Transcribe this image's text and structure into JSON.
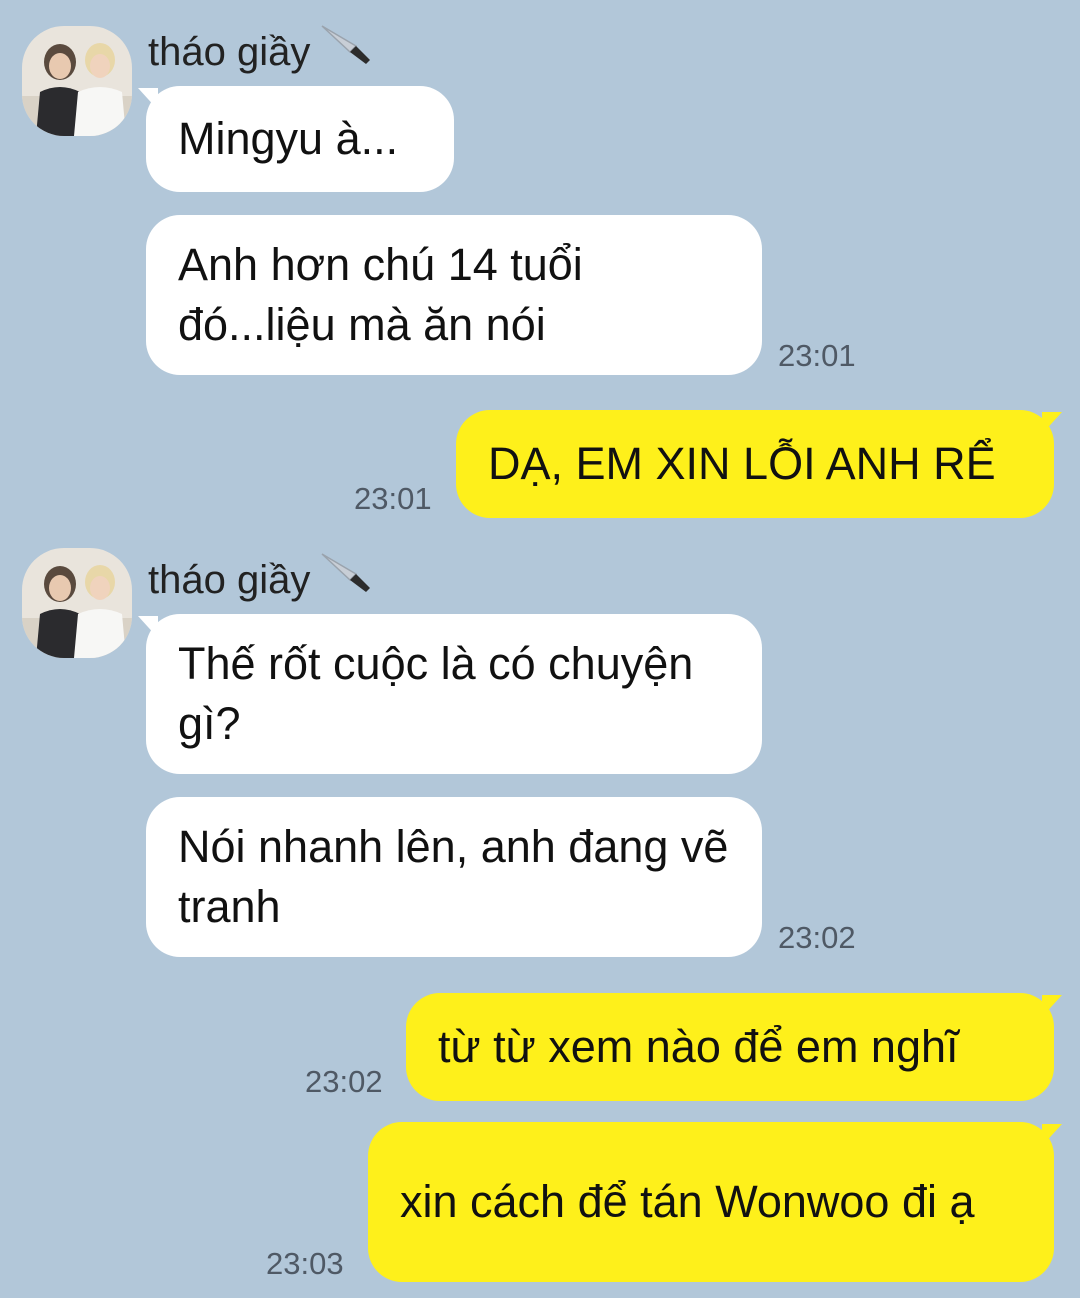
{
  "sender": {
    "name": "tháo giầy",
    "emoji_icon": "kitchen-knife-icon"
  },
  "messages": [
    {
      "from": "other",
      "text": "Mingyu à..."
    },
    {
      "from": "other",
      "text": "Anh hơn chú 14 tuổi đó...liệu mà ăn nói",
      "time": "23:01"
    },
    {
      "from": "me",
      "text": "DẠ, EM XIN LỖI ANH RỂ",
      "time": "23:01"
    },
    {
      "from": "other",
      "text": "Thế rốt cuộc là có chuyện gì?"
    },
    {
      "from": "other",
      "text": "Nói nhanh lên, anh đang vẽ tranh",
      "time": "23:02"
    },
    {
      "from": "me",
      "text": "từ từ xem nào để em nghĩ",
      "time": "23:02"
    },
    {
      "from": "me",
      "text": "xin cách để tán Wonwoo đi ạ",
      "time": "23:03"
    }
  ],
  "colors": {
    "background": "#b2c7d9",
    "incoming_bubble": "#ffffff",
    "outgoing_bubble": "#fef01b"
  }
}
